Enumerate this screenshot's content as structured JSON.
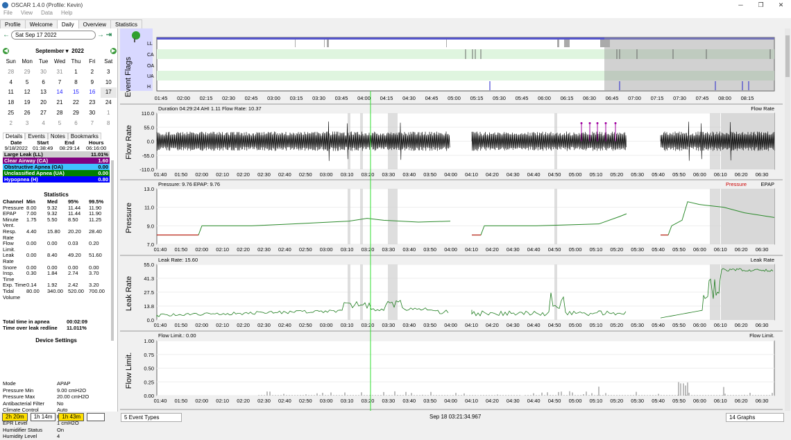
{
  "window": {
    "title": "OSCAR 1.4.0 (Profile: Kevin)",
    "minimize": "─",
    "restore": "❐",
    "close": "✕"
  },
  "menu": [
    "File",
    "View",
    "Data",
    "Help"
  ],
  "tabs": [
    "Profile",
    "Welcome",
    "Daily",
    "Overview",
    "Statistics"
  ],
  "date_nav": {
    "back": "←",
    "date": "Sat Sep 17 2022",
    "forward": "→",
    "last": "⇥"
  },
  "calendar": {
    "month": "September",
    "year": "2022",
    "day_names": [
      "Sun",
      "Mon",
      "Tue",
      "Wed",
      "Thu",
      "Fri",
      "Sat"
    ],
    "days": [
      "28",
      "29",
      "30",
      "31",
      "1",
      "2",
      "3",
      "4",
      "5",
      "6",
      "7",
      "8",
      "9",
      "10",
      "11",
      "12",
      "13",
      "14",
      "15",
      "16",
      "17",
      "18",
      "19",
      "20",
      "21",
      "22",
      "23",
      "24",
      "25",
      "26",
      "27",
      "28",
      "29",
      "30",
      "1",
      "2",
      "3",
      "4",
      "5",
      "6",
      "7",
      "8"
    ]
  },
  "subtabs": [
    "Details",
    "Events",
    "Notes",
    "Bookmarks"
  ],
  "session": {
    "headers": [
      "Date",
      "Start",
      "End",
      "Hours"
    ],
    "values": [
      "9/18/2022",
      "01:38:49",
      "08:29:14",
      "06:16:00"
    ]
  },
  "events": [
    {
      "label": "Large Leak (LL)",
      "value": "11.01%",
      "bg": "#cfcfcf",
      "fg": "#000000"
    },
    {
      "label": "Clear Airway (CA)",
      "value": "1.60",
      "bg": "#800080",
      "fg": "#ffffff"
    },
    {
      "label": "Obstructive Apnea (OA)",
      "value": "0.00",
      "bg": "#40c0ff",
      "fg": "#000000"
    },
    {
      "label": "Unclassified Apnea (UA)",
      "value": "0.00",
      "bg": "#008000",
      "fg": "#ffffff"
    },
    {
      "label": "Hypopnea (H)",
      "value": "0.80",
      "bg": "#0000ff",
      "fg": "#ffffff"
    }
  ],
  "statistics": {
    "title": "Statistics",
    "headers": [
      "Channel",
      "Min",
      "Med",
      "95%",
      "99.5%"
    ],
    "rows": [
      [
        "Pressure",
        "8.00",
        "9.32",
        "11.44",
        "11.90"
      ],
      [
        "EPAP",
        "7.00",
        "9.32",
        "11.44",
        "11.90"
      ],
      [
        "Minute Vent.",
        "1.75",
        "5.50",
        "8.50",
        "11.25"
      ],
      [
        "Resp. Rate",
        "4.40",
        "15.80",
        "20.20",
        "28.40"
      ],
      [
        "Flow Limit.",
        "0.00",
        "0.00",
        "0.03",
        "0.20"
      ],
      [
        "Leak Rate",
        "0.00",
        "8.40",
        "49.20",
        "51.60"
      ],
      [
        "Snore",
        "0.00",
        "0.00",
        "0.00",
        "0.00"
      ],
      [
        "Insp. Time",
        "0.30",
        "1.84",
        "2.74",
        "3.70"
      ],
      [
        "Exp. Time",
        "0.14",
        "1.92",
        "2.42",
        "3.20"
      ],
      [
        "Tidal Volume",
        "80.00",
        "340.00",
        "520.00",
        "700.00"
      ]
    ]
  },
  "summary": [
    {
      "label": "Total time in apnea",
      "value": "00:02:09"
    },
    {
      "label": "Time over leak redline",
      "value": "11.011%"
    }
  ],
  "device": {
    "title": "Device Settings",
    "rows": [
      [
        "Mode",
        "APAP"
      ],
      [
        "Pressure Min",
        "9.00 cmH2O"
      ],
      [
        "Pressure Max",
        "20.00 cmH2O"
      ],
      [
        "Antibacterial Filter",
        "No"
      ],
      [
        "Climate Control",
        "Auto"
      ],
      [
        "EPR",
        "Ramp Only"
      ],
      [
        "EPR Level",
        "1 cmH2O"
      ],
      [
        "Humidifier Status",
        "On"
      ],
      [
        "Humidity Level",
        "4"
      ]
    ]
  },
  "bottom_buttons": [
    "2h 20m",
    "1h 14m",
    "1h 43m",
    ""
  ],
  "status": {
    "event_types": "5 Event Types",
    "timestamp": "Sep 18 03:21:34.967",
    "graphs": "14 Graphs"
  },
  "graphs": {
    "event_flags": {
      "ylabel": "Event Flags",
      "rows": [
        "LL",
        "CA",
        "OA",
        "UA",
        "H"
      ],
      "xticks": [
        "01:45",
        "02:00",
        "02:15",
        "02:30",
        "02:45",
        "03:00",
        "03:15",
        "03:30",
        "03:45",
        "04:00",
        "04:15",
        "04:30",
        "04:45",
        "05:00",
        "05:15",
        "05:30",
        "05:45",
        "06:00",
        "06:15",
        "06:30",
        "06:45",
        "07:00",
        "07:15",
        "07:30",
        "07:45",
        "08:00",
        "08:15"
      ]
    },
    "flow_rate": {
      "ylabel": "Flow Rate",
      "header": "Duration 04:29:24 AHI 1.11 Flow Rate: 10.37",
      "legend": "Flow Rate",
      "yticks": [
        "110.0",
        "55.0",
        "0.0",
        "-55.0",
        "-110.0"
      ]
    },
    "pressure": {
      "ylabel": "Pressure",
      "header": "Pressure: 9.76 EPAP: 9.76",
      "legend": "EPAP",
      "legend2": "Pressure",
      "yticks": [
        "13.0",
        "11.0",
        "9.0",
        "7.0"
      ]
    },
    "leak_rate": {
      "ylabel": "Leak Rate",
      "header": "Leak Rate: 15.60",
      "legend": "Leak Rate",
      "yticks": [
        "55.0",
        "41.3",
        "27.5",
        "13.8",
        "0.0"
      ]
    },
    "flow_limit": {
      "ylabel": "Flow Limit.",
      "header": "Flow Limit.: 0.00",
      "legend": "Flow Limit.",
      "yticks": [
        "1.00",
        "0.75",
        "0.50",
        "0.25",
        "0.00"
      ]
    },
    "xticks": [
      "01:40",
      "01:50",
      "02:00",
      "02:10",
      "02:20",
      "02:30",
      "02:40",
      "02:50",
      "03:00",
      "03:10",
      "03:20",
      "03:30",
      "03:40",
      "03:50",
      "04:00",
      "04:10",
      "04:20",
      "04:30",
      "04:40",
      "04:50",
      "05:00",
      "05:10",
      "05:20",
      "05:30",
      "05:40",
      "05:50",
      "06:00",
      "06:10",
      "06:20",
      "06:30"
    ]
  }
}
